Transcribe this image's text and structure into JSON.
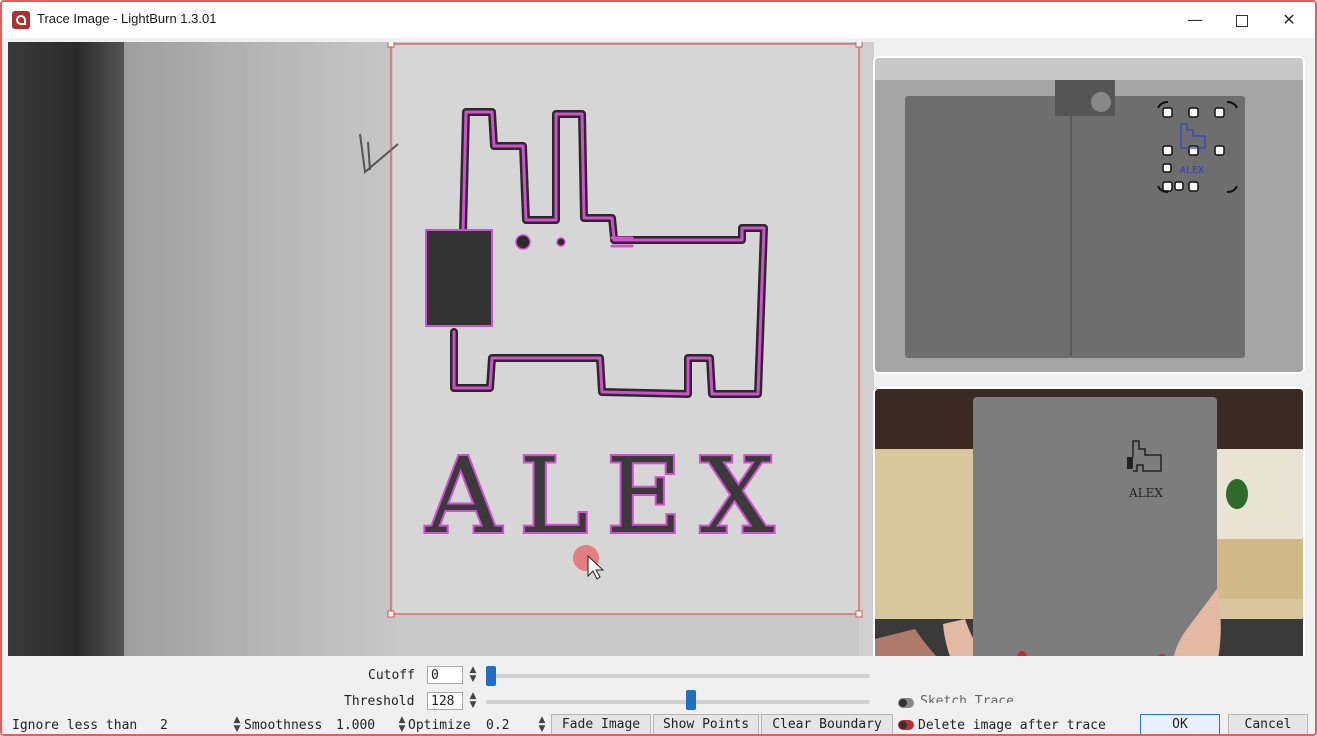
{
  "window": {
    "title": "Trace Image - LightBurn 1.3.01",
    "minimize_glyph": "—",
    "close_glyph": "✕"
  },
  "canvas": {
    "traced_text": "ALEX"
  },
  "preview_top": {
    "overlay_text": "ALEX"
  },
  "preview_bottom": {
    "notebook_text": "ALEX"
  },
  "controls": {
    "cutoff_label": "Cutoff",
    "cutoff_value": "0",
    "threshold_label": "Threshold",
    "threshold_value": "128",
    "sketch_trace_label": "Sketch Trace",
    "ignore_label": "Ignore less than",
    "ignore_value": "2",
    "smoothness_label": "Smoothness",
    "smoothness_value": "1.000",
    "optimize_label": "Optimize",
    "optimize_value": "0.2",
    "fade_image_label": "Fade Image",
    "show_points_label": "Show Points",
    "clear_boundary_label": "Clear Boundary",
    "delete_image_label": "Delete image after trace",
    "ok_label": "OK",
    "cancel_label": "Cancel",
    "cutoff_slider_level": 0.0,
    "threshold_slider_level": 0.5
  },
  "colors": {
    "trace_outline": "#d24fd2",
    "selection_box": "#e05050",
    "slider_accent": "#1f6fc4",
    "window_border": "#e06060"
  }
}
